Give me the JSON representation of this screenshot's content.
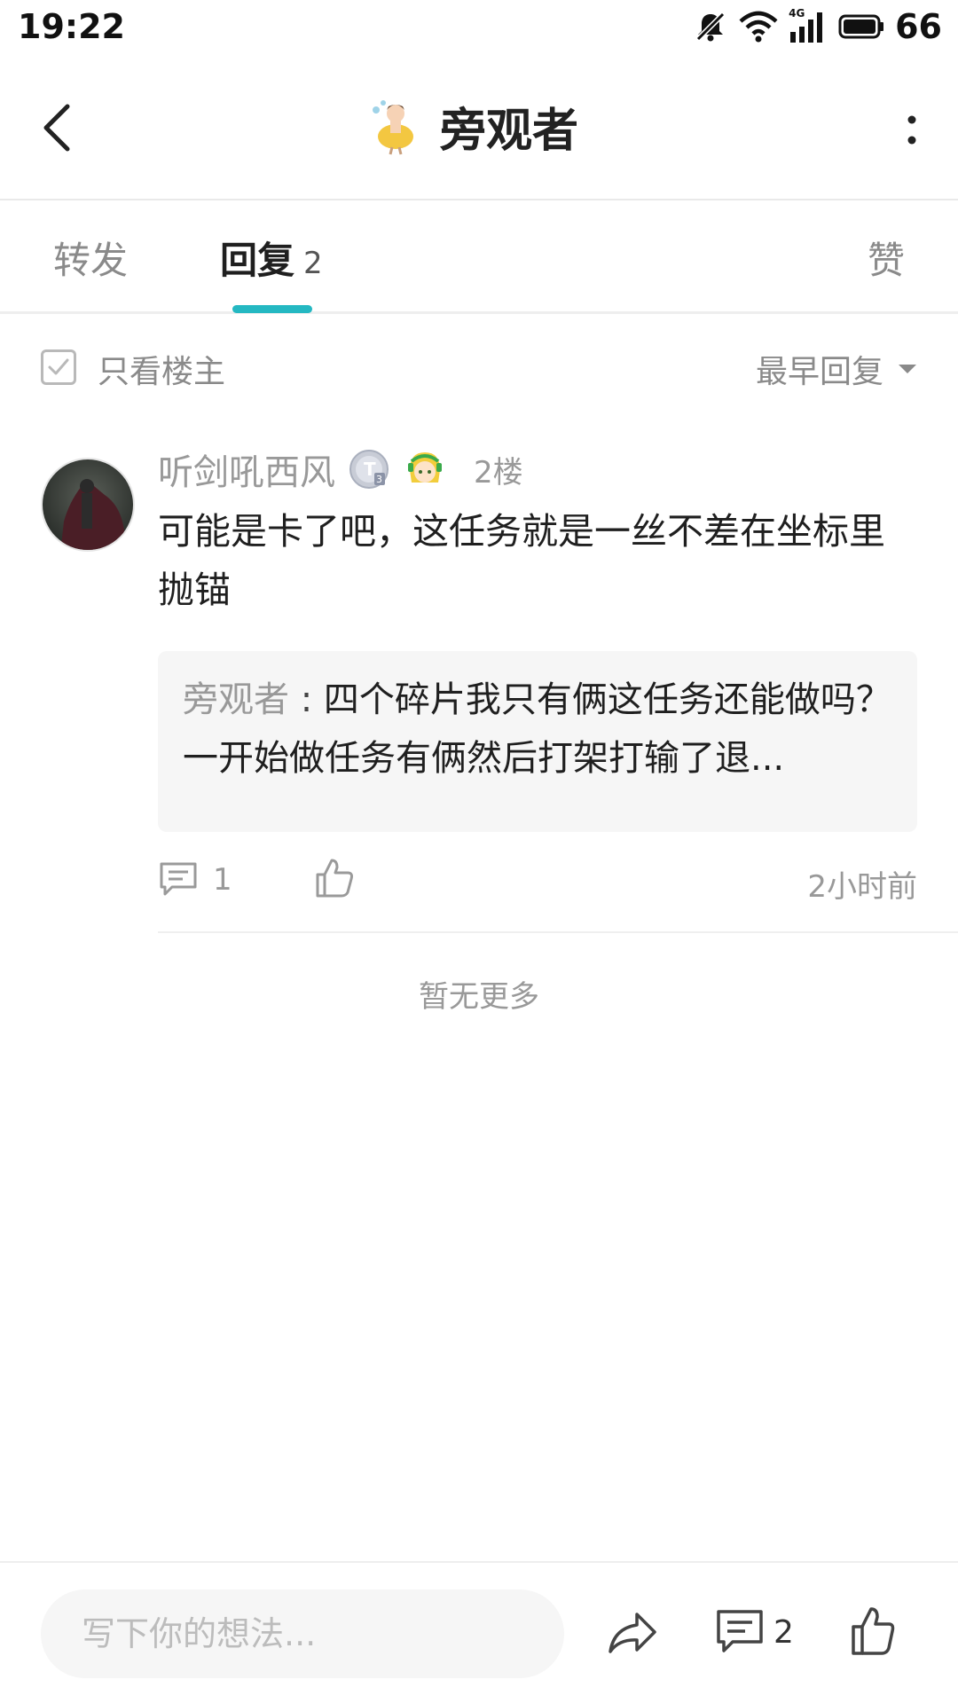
{
  "status_bar": {
    "time": "19:22",
    "network": "4G",
    "battery": "66"
  },
  "header": {
    "title": "旁观者",
    "back_icon": "chevron-left-icon",
    "more_icon": "more-vertical-icon"
  },
  "tabs": {
    "forward": "转发",
    "reply": "回复",
    "reply_count": "2",
    "like": "赞",
    "active_color": "#24b8c2"
  },
  "filter": {
    "only_owner": "只看楼主",
    "sort": "最早回复"
  },
  "comment": {
    "username": "听剑吼西风",
    "floor": "2楼",
    "text": "可能是卡了吧，这任务就是一丝不差在坐标里抛锚",
    "quote_author": "旁观者",
    "quote_separator": " : ",
    "quote_text": "四个碎片我只有俩这任务还能做吗？一开始做任务有俩然后打架打输了退...",
    "reply_count": "1",
    "time": "2小时前"
  },
  "no_more": "暂无更多",
  "bottom_bar": {
    "input_placeholder": "写下你的想法...",
    "comment_count": "2"
  }
}
